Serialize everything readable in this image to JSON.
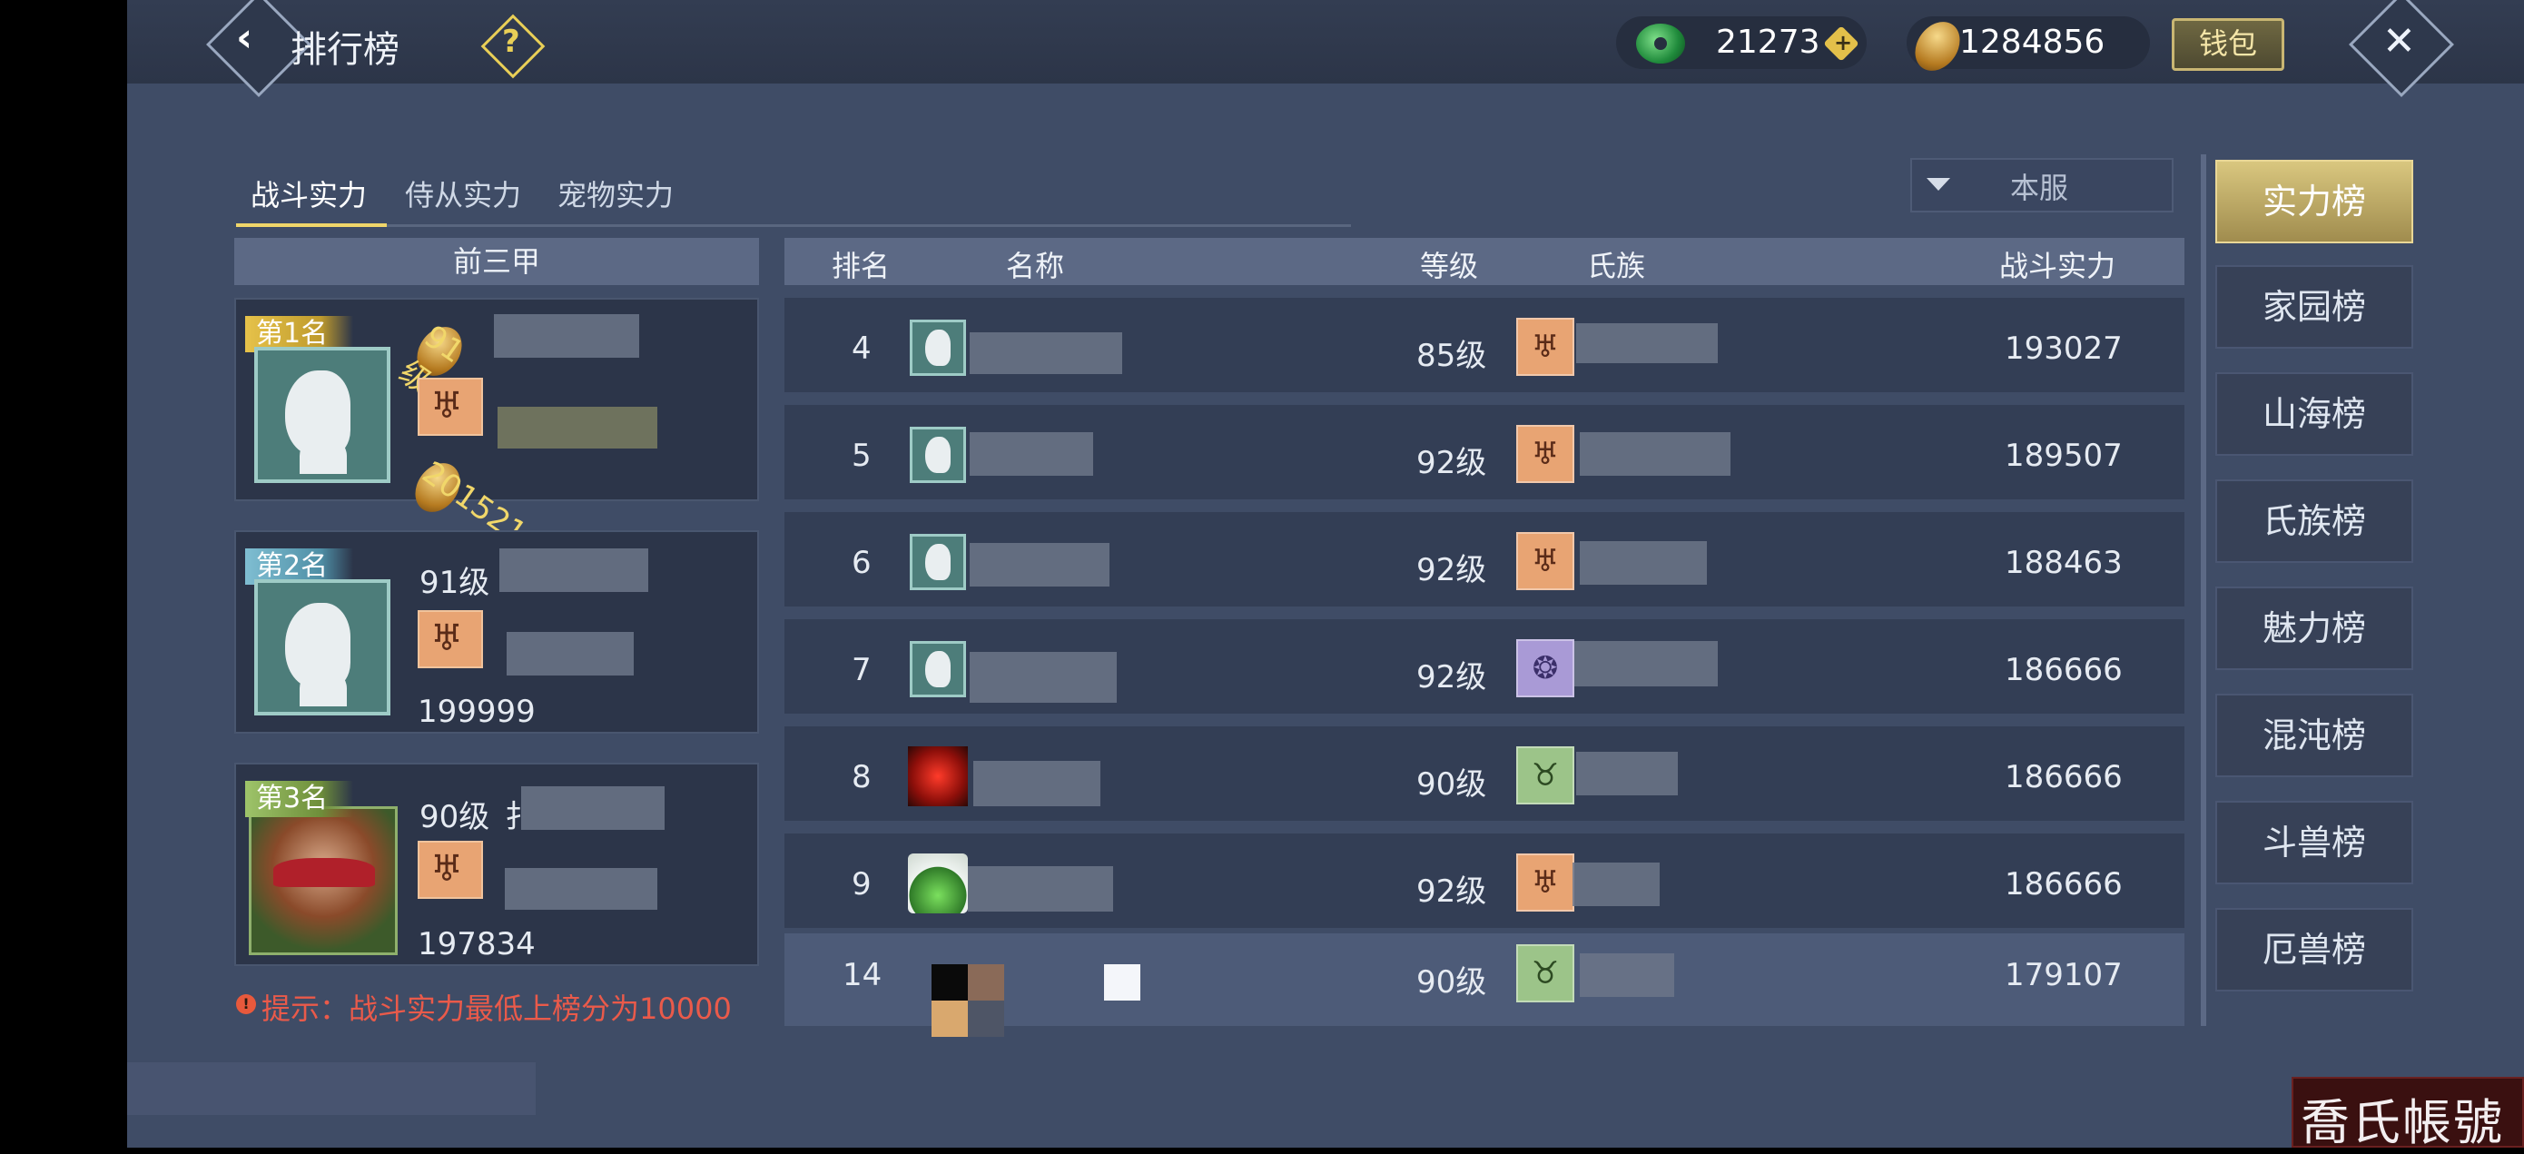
{
  "header": {
    "title": "排行榜",
    "back_icon": "chevron-left-icon",
    "help_icon": "question-icon",
    "help_label": "?",
    "close_icon": "close-x-icon",
    "close_label": "✕"
  },
  "currency": {
    "jade": "21273",
    "add_label": "+",
    "gold": "1284856",
    "wallet_label": "钱包"
  },
  "tabs": [
    {
      "label": "战斗实力",
      "active": true
    },
    {
      "label": "侍从实力",
      "active": false
    },
    {
      "label": "宠物实力",
      "active": false
    }
  ],
  "server_filter": {
    "value": "本服"
  },
  "top3": {
    "header": "前三甲",
    "entries": [
      {
        "rank_label": "第1名",
        "level": "91级",
        "power": "201521"
      },
      {
        "rank_label": "第2名",
        "level": "91级",
        "power": "199999"
      },
      {
        "rank_label": "第3名",
        "level": "90级",
        "name_visible": "扌",
        "power": "197834"
      }
    ],
    "tip": "提示：战斗实力最低上榜分为10000",
    "tip_icon": "!"
  },
  "table": {
    "columns": {
      "rank": "排名",
      "name": "名称",
      "level": "等级",
      "clan": "氏族",
      "power": "战斗实力"
    },
    "rows": [
      {
        "rank": "4",
        "level": "85级",
        "power": "193027",
        "clan_color": "#e8a473"
      },
      {
        "rank": "5",
        "level": "92级",
        "power": "189507",
        "clan_color": "#e8a473"
      },
      {
        "rank": "6",
        "level": "92级",
        "power": "188463",
        "clan_color": "#e8a473"
      },
      {
        "rank": "7",
        "level": "92级",
        "power": "186666",
        "clan_color": "#a99ad6"
      },
      {
        "rank": "8",
        "level": "90级",
        "power": "186666",
        "clan_color": "#9cc489"
      },
      {
        "rank": "9",
        "level": "92级",
        "power": "186666",
        "clan_color": "#e8a473"
      },
      {
        "rank": "14",
        "level": "90级",
        "power": "179107",
        "clan_color": "#9cc489"
      }
    ]
  },
  "categories": [
    {
      "label": "实力榜",
      "active": true
    },
    {
      "label": "家园榜",
      "active": false
    },
    {
      "label": "山海榜",
      "active": false
    },
    {
      "label": "氏族榜",
      "active": false
    },
    {
      "label": "魅力榜",
      "active": false
    },
    {
      "label": "混沌榜",
      "active": false
    },
    {
      "label": "斗兽榜",
      "active": false
    },
    {
      "label": "厄兽榜",
      "active": false
    }
  ],
  "watermark": "喬氏帳號",
  "colors": {
    "accent_gold": "#f1d76a",
    "tip_red": "#ea5a4a",
    "panel_bg": "#3f4c66"
  }
}
